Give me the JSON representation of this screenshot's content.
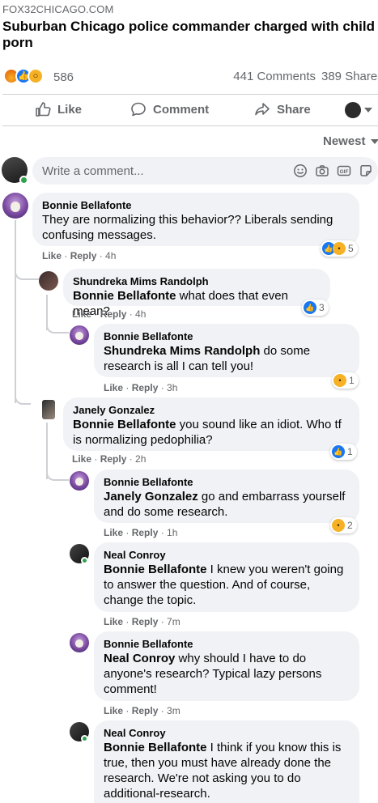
{
  "post": {
    "source": "FOX32CHICAGO.COM",
    "headline": "Suburban Chicago police commander charged with child porn"
  },
  "stats": {
    "reaction_count": "586",
    "comments": "441 Comments",
    "shares": "389 Shares"
  },
  "actions": {
    "like": "Like",
    "comment": "Comment",
    "share": "Share"
  },
  "sort": {
    "label": "Newest"
  },
  "composer": {
    "placeholder": "Write a comment..."
  },
  "comments": [
    {
      "author": "Bonnie Bellafonte",
      "mention": "",
      "text": "They are normalizing this behavior?? Liberals sending confusing messages.",
      "like": "Like",
      "reply": "Reply",
      "time": "4h",
      "reaction_count": "5"
    },
    {
      "author": "Shundreka Mims Randolph",
      "mention": "Bonnie Bellafonte",
      "text": " what does that even mean?",
      "like": "Like",
      "reply": "Reply",
      "time": "4h",
      "reaction_count": "3"
    },
    {
      "author": "Bonnie Bellafonte",
      "mention": "Shundreka Mims Randolph",
      "text": " do some research is all I can tell you!",
      "like": "Like",
      "reply": "Reply",
      "time": "3h",
      "reaction_count": "1"
    },
    {
      "author": "Janely Gonzalez",
      "mention": "Bonnie Bellafonte",
      "text": " you sound like an idiot. Who tf is normalizing pedophilia?",
      "like": "Like",
      "reply": "Reply",
      "time": "2h",
      "reaction_count": "1"
    },
    {
      "author": "Bonnie Bellafonte",
      "mention": "Janely Gonzalez",
      "text": " go and embarrass yourself and do some research.",
      "like": "Like",
      "reply": "Reply",
      "time": "1h",
      "reaction_count": "2"
    },
    {
      "author": "Neal Conroy",
      "mention": "Bonnie Bellafonte",
      "text": " I knew you weren't going to answer the question. And of course, change the topic.",
      "like": "Like",
      "reply": "Reply",
      "time": "7m"
    },
    {
      "author": "Bonnie Bellafonte",
      "mention": "Neal Conroy",
      "text": " why should I have to do anyone's research? Typical lazy persons comment!",
      "like": "Like",
      "reply": "Reply",
      "time": "3m"
    },
    {
      "author": "Neal Conroy",
      "mention": "Bonnie Bellafonte",
      "text": " I think if you know this is true, then you must have already done the research. We're not asking you to do additional-research."
    }
  ],
  "colors": {
    "accent": "#1877f2",
    "bubble": "#f0f2f5",
    "secondary_text": "#65676b",
    "online": "#31a24c"
  },
  "icons": [
    "like-icon",
    "comment-icon",
    "share-icon",
    "caret-down-icon",
    "emoji-icon",
    "camera-icon",
    "gif-icon",
    "sticker-icon"
  ]
}
